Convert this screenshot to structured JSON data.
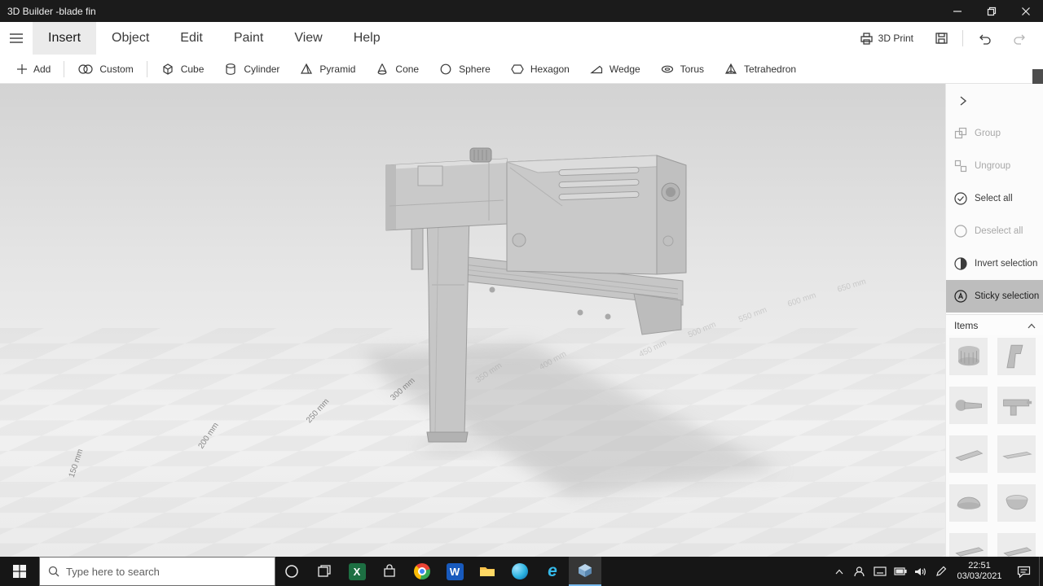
{
  "titlebar": {
    "title": "3D Builder -blade fin"
  },
  "menubar": {
    "items": [
      {
        "label": "Insert",
        "active": true
      },
      {
        "label": "Object",
        "active": false
      },
      {
        "label": "Edit",
        "active": false
      },
      {
        "label": "Paint",
        "active": false
      },
      {
        "label": "View",
        "active": false
      },
      {
        "label": "Help",
        "active": false
      }
    ],
    "print_label": "3D Print"
  },
  "toolbar": {
    "add_label": "Add",
    "custom_label": "Custom",
    "shapes": [
      {
        "label": "Cube"
      },
      {
        "label": "Cylinder"
      },
      {
        "label": "Pyramid"
      },
      {
        "label": "Cone"
      },
      {
        "label": "Sphere"
      },
      {
        "label": "Hexagon"
      },
      {
        "label": "Wedge"
      },
      {
        "label": "Torus"
      },
      {
        "label": "Tetrahedron"
      }
    ]
  },
  "right_panel": {
    "buttons": [
      {
        "label": "Group",
        "state": "disabled"
      },
      {
        "label": "Ungroup",
        "state": "disabled"
      },
      {
        "label": "Select all",
        "state": "normal"
      },
      {
        "label": "Deselect all",
        "state": "disabled"
      },
      {
        "label": "Invert selection",
        "state": "normal"
      },
      {
        "label": "Sticky selection",
        "state": "active"
      }
    ],
    "items_header": "Items"
  },
  "viewport": {
    "ruler_labels": [
      {
        "text": "150 mm"
      },
      {
        "text": "200 mm"
      },
      {
        "text": "250 mm"
      },
      {
        "text": "300 mm"
      },
      {
        "text": "350 mm"
      },
      {
        "text": "400 mm"
      },
      {
        "text": "450 mm"
      },
      {
        "text": "500 mm"
      },
      {
        "text": "550 mm"
      },
      {
        "text": "600 mm"
      },
      {
        "text": "650 mm"
      }
    ]
  },
  "taskbar": {
    "search_placeholder": "Type here to search",
    "clock": {
      "time": "22:51",
      "date": "03/03/2021"
    }
  },
  "colors": {
    "accent": "#0078d7",
    "titlebar_bg": "#1b1b1b",
    "taskbar_bg": "#161616"
  }
}
